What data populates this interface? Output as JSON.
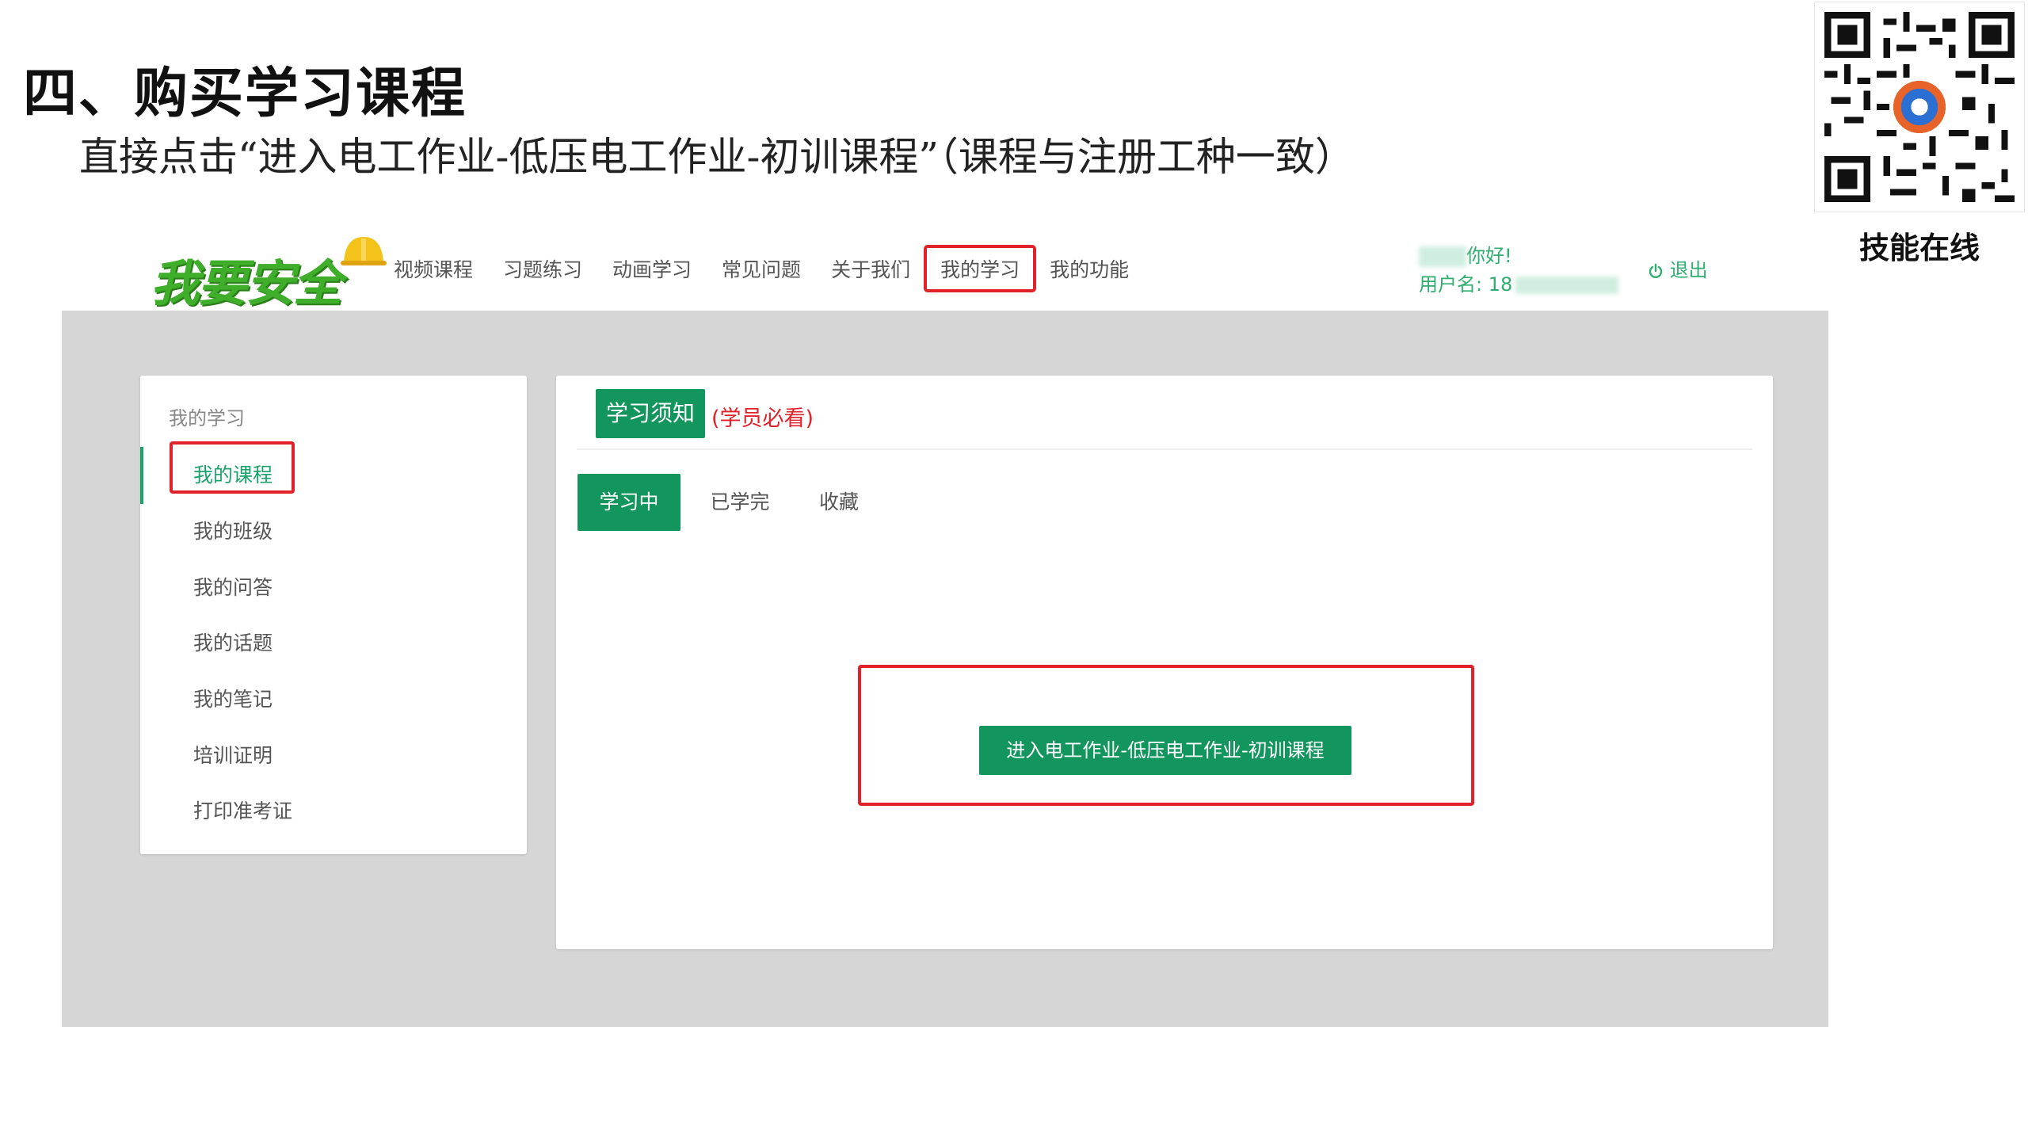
{
  "slide": {
    "title": "四、购买学习课程",
    "subtitle": "直接点击“进入电工作业-低压电工作业-初训课程”（课程与注册工种一致）",
    "qr_caption": "技能在线"
  },
  "header": {
    "logo_text": "我要安全",
    "nav": [
      "视频课程",
      "习题练习",
      "动画学习",
      "常见问题",
      "关于我们",
      "我的学习",
      "我的功能"
    ],
    "greeting_suffix": "你好!",
    "username_label": "用户名: 18",
    "logout": "退出",
    "logout_icon": "power-icon"
  },
  "sidebar": {
    "heading": "我的学习",
    "items": [
      "我的课程",
      "我的班级",
      "我的问答",
      "我的话题",
      "我的笔记",
      "培训证明",
      "打印准考证"
    ]
  },
  "content": {
    "notice_tab": "学习须知",
    "notice_note": "(学员必看)",
    "tabs": [
      "学习中",
      "已学完",
      "收藏"
    ],
    "course_button": "进入电工作业-低压电工作业-初训课程"
  },
  "colors": {
    "accent_green": "#13965e",
    "highlight_red": "#e2222a",
    "logo_green": "#3fae2a",
    "panel_grey": "#d6d6d6"
  }
}
